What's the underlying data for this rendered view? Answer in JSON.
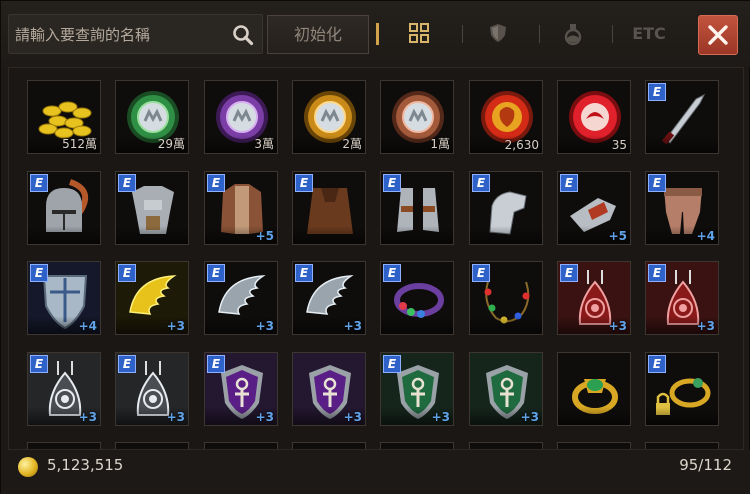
{
  "search": {
    "placeholder": "請輸入要查詢的名稱"
  },
  "toolbar": {
    "reset_label": "初始化",
    "etc_label": "ETC",
    "accent": "#d4a24a"
  },
  "rows": [
    [
      {
        "icon": "gold-coins",
        "qty": "512萬",
        "e": false,
        "enh": ""
      },
      {
        "icon": "green-silver-coin",
        "qty": "29萬",
        "e": false,
        "enh": ""
      },
      {
        "icon": "purple-silver-coin",
        "qty": "3萬",
        "e": false,
        "enh": ""
      },
      {
        "icon": "gold-silver-coin",
        "qty": "2萬",
        "e": false,
        "enh": ""
      },
      {
        "icon": "copper-silver-coin",
        "qty": "1萬",
        "e": false,
        "enh": ""
      },
      {
        "icon": "red-lion-medal",
        "qty": "2,630",
        "e": false,
        "enh": ""
      },
      {
        "icon": "red-emblem-medal",
        "qty": "35",
        "e": false,
        "enh": ""
      },
      {
        "icon": "dagger",
        "qty": "",
        "e": true,
        "enh": ""
      }
    ],
    [
      {
        "icon": "plumed-helmet",
        "qty": "",
        "e": true,
        "enh": ""
      },
      {
        "icon": "plate-armor",
        "qty": "",
        "e": true,
        "enh": ""
      },
      {
        "icon": "leather-coat",
        "qty": "",
        "e": true,
        "enh": "+5"
      },
      {
        "icon": "cloak",
        "qty": "",
        "e": true,
        "enh": ""
      },
      {
        "icon": "greaves",
        "qty": "",
        "e": true,
        "enh": ""
      },
      {
        "icon": "gauntlet",
        "qty": "",
        "e": true,
        "enh": ""
      },
      {
        "icon": "vambrace",
        "qty": "",
        "e": true,
        "enh": "+5"
      },
      {
        "icon": "leg-armor",
        "qty": "",
        "e": true,
        "enh": "+4"
      }
    ],
    [
      {
        "icon": "kite-shield",
        "qty": "",
        "e": true,
        "enh": "+4"
      },
      {
        "icon": "golden-wing",
        "qty": "",
        "e": true,
        "enh": "+3"
      },
      {
        "icon": "silver-wing",
        "qty": "",
        "e": true,
        "enh": "+3"
      },
      {
        "icon": "silver-wing",
        "qty": "",
        "e": true,
        "enh": "+3"
      },
      {
        "icon": "jeweled-ring",
        "qty": "",
        "e": true,
        "enh": ""
      },
      {
        "icon": "gem-necklace",
        "qty": "",
        "e": true,
        "enh": ""
      },
      {
        "icon": "red-amulet",
        "qty": "",
        "e": true,
        "enh": "+3"
      },
      {
        "icon": "red-amulet",
        "qty": "",
        "e": true,
        "enh": "+3"
      }
    ],
    [
      {
        "icon": "silver-amulet",
        "qty": "",
        "e": true,
        "enh": "+3"
      },
      {
        "icon": "silver-amulet",
        "qty": "",
        "e": true,
        "enh": "+3"
      },
      {
        "icon": "purple-ankh-shield",
        "qty": "",
        "e": true,
        "enh": "+3"
      },
      {
        "icon": "purple-ankh-shield",
        "qty": "",
        "e": false,
        "enh": "+3"
      },
      {
        "icon": "green-ankh-shield",
        "qty": "",
        "e": true,
        "enh": "+3"
      },
      {
        "icon": "green-ankh-shield",
        "qty": "",
        "e": false,
        "enh": "+3"
      },
      {
        "icon": "emerald-ring",
        "qty": "",
        "e": false,
        "enh": ""
      },
      {
        "icon": "locked-ring",
        "qty": "",
        "e": true,
        "enh": ""
      }
    ]
  ],
  "footer": {
    "money": "5,123,515",
    "capacity": "95/112"
  }
}
